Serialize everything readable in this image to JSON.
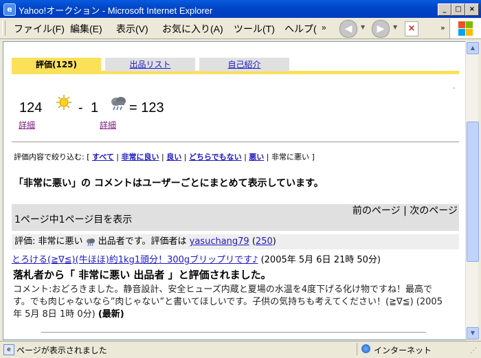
{
  "window": {
    "title": "Yahoo!オークション - Microsoft Internet Explorer",
    "icon": "ie-icon",
    "min": "_",
    "max": "□",
    "close": "×"
  },
  "menu": {
    "items": [
      "ファイル(F)",
      "編集(E)",
      "表示(V)",
      "お気に入り(A)",
      "ツール(T)",
      "ヘルプ("
    ],
    "overflow": "»",
    "overflow2": "»"
  },
  "page": {
    "tabs": [
      {
        "label": "評価(125)",
        "active": true
      },
      {
        "label": "出品リスト",
        "active": false
      },
      {
        "label": "自己紹介",
        "active": false
      }
    ],
    "score": {
      "good_count": "124",
      "minus": "-",
      "bad_count": "1",
      "equals": "= 123",
      "detail_label": "詳細"
    },
    "filter": {
      "prefix": "評価内容で絞り込む: [",
      "links": [
        "すべて",
        "非常に良い",
        "良い",
        "どちらでもない",
        "悪い"
      ],
      "current": "非常に悪い",
      "suffix": "]"
    },
    "heading": "「非常に悪い」の コメントはユーザーごとにまとめて表示しています。",
    "pagination": {
      "count_text": "1ページ中1ページ目を表示",
      "prev": "前のページ",
      "sep": "|",
      "next": "次のページ"
    },
    "entry": {
      "rating_text": "評価: 非常に悪い",
      "role_text": "出品者です。評価者は",
      "user": "yasuchang79",
      "user_score": "250",
      "item_title": "とろける(≧∇≦)(牛ほほ)約1kg1頭分！300gブリップリです♪",
      "item_date": "(2005年 5月 6日 21時 50分)",
      "eval_heading": "落札者から「 非常に悪い 出品者 」と評価されました。",
      "comment": "コメント:おどろきました。静音設計、安全ヒューズ内蔵と夏場の水温を4度下げる化け物ですね！最高です。でも肉じゃないなら”肉じゃない”と書いてほしいです。子供の気持ちも考えてください！(≧∇≦) (2005年 5月 8日 1時 0分)",
      "latest": "(最新)"
    }
  },
  "status": {
    "text": "ページが表示されました",
    "zone": "インターネット"
  },
  "colors": {
    "tab_active": "#fbe05a",
    "link": "#1b18c4",
    "visited": "#7b1a7f",
    "titlebar": "#0047c8"
  }
}
